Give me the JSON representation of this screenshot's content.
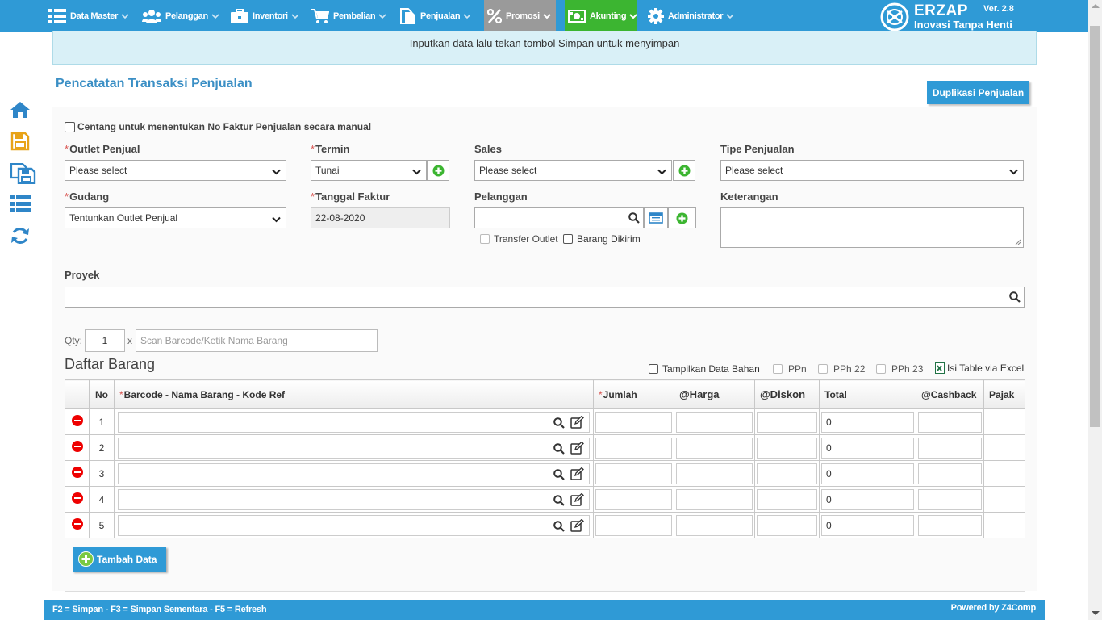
{
  "nav": {
    "items": [
      {
        "label": "Data Master",
        "icon": "list-icon"
      },
      {
        "label": "Pelanggan",
        "icon": "users-icon"
      },
      {
        "label": "Inventori",
        "icon": "briefcase-icon"
      },
      {
        "label": "Pembelian",
        "icon": "cart-icon"
      },
      {
        "label": "Penjualan",
        "icon": "document-icon"
      },
      {
        "label": "Promosi",
        "icon": "percent-icon"
      },
      {
        "label": "Akunting",
        "icon": "money-icon"
      },
      {
        "label": "Administrator",
        "icon": "gear-icon"
      }
    ],
    "brand_name": "ERZAP",
    "brand_version": "Ver. 2.8",
    "brand_tagline": "Inovasi Tanpa Henti"
  },
  "banner": {
    "text": "Inputkan data lalu tekan tombol Simpan untuk menyimpan"
  },
  "page": {
    "title": "Pencatatan Transaksi Penjualan",
    "duplicate_button": "Duplikasi Penjualan"
  },
  "form": {
    "manual_invoice_label": "Centang untuk menentukan No Faktur Penjualan secara manual",
    "outlet_label": "Outlet Penjual",
    "outlet_value": "Please select",
    "termin_label": "Termin",
    "termin_value": "Tunai",
    "sales_label": "Sales",
    "sales_value": "Please select",
    "tipe_label": "Tipe Penjualan",
    "tipe_value": "Please select",
    "gudang_label": "Gudang",
    "gudang_value": "Tentunkan Outlet Penjual",
    "tanggal_label": "Tanggal Faktur",
    "tanggal_value": "22-08-2020",
    "pelanggan_label": "Pelanggan",
    "pelanggan_value": "",
    "transfer_outlet_label": "Transfer Outlet",
    "barang_dikirim_label": "Barang Dikirim",
    "keterangan_label": "Keterangan",
    "proyek_label": "Proyek",
    "qty_label": "Qty:",
    "qty_value": "1",
    "qty_x": "x",
    "scan_placeholder": "Scan Barcode/Ketik Nama Barang"
  },
  "items": {
    "title": "Daftar Barang",
    "options": {
      "tampilkan": "Tampilkan Data Bahan",
      "ppn": "PPn",
      "pph22": "PPh 22",
      "pph23": "PPh 23",
      "excel": "Isi Table via Excel"
    },
    "columns": {
      "no": "No",
      "barcode": "Barcode - Nama Barang - Kode Ref",
      "jumlah": "Jumlah",
      "harga": "@Harga",
      "diskon": "@Diskon",
      "total": "Total",
      "cashback": "@Cashback",
      "pajak": "Pajak"
    },
    "rows": [
      {
        "no": "1",
        "total": "0"
      },
      {
        "no": "2",
        "total": "0"
      },
      {
        "no": "3",
        "total": "0"
      },
      {
        "no": "4",
        "total": "0"
      },
      {
        "no": "5",
        "total": "0"
      }
    ],
    "add_button": "Tambah Data"
  },
  "footer": {
    "shortcuts": "F2 = Simpan - F3 = Simpan Sementara - F5 = Refresh",
    "powered": "Powered by Z4Comp"
  },
  "colors": {
    "primary": "#2f9ad6",
    "active_promosi": "#9a9a9a",
    "active_akunting": "#3cb531",
    "danger": "#e00000",
    "add_green": "#3cb531"
  }
}
